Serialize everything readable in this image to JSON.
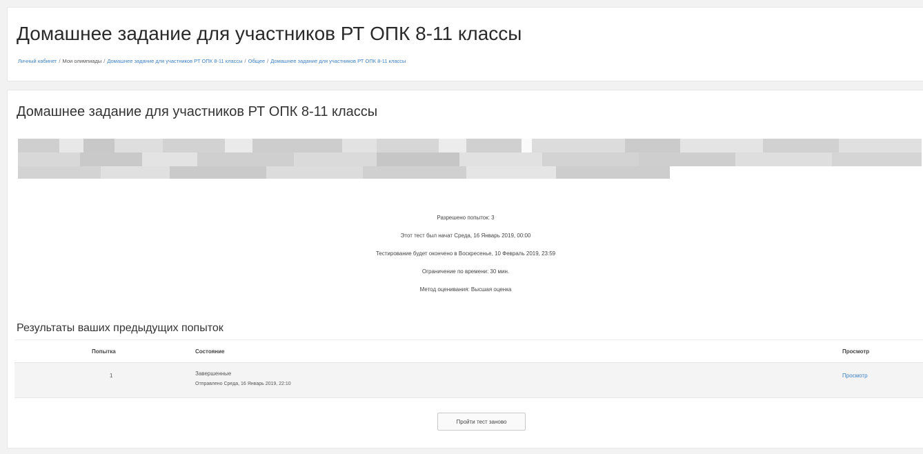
{
  "header": {
    "title": "Домашнее задание для участников РТ ОПК 8-11 классы",
    "breadcrumb": [
      {
        "label": "Личный кабинет",
        "link": true
      },
      {
        "label": "Мои олимпиады",
        "link": false
      },
      {
        "label": "Домашнее задание для участников РТ ОПК 8-11 классы",
        "link": true
      },
      {
        "label": "Общее",
        "link": true
      },
      {
        "label": "Домашнее задание для участников РТ ОПК 8-11 классы",
        "link": true
      }
    ],
    "breadcrumb_separator": "/"
  },
  "quiz": {
    "title": "Домашнее задание для участников РТ ОПК 8-11 классы",
    "info": {
      "attempts": "Разрешено попыток: 3",
      "opened": "Этот тест был начат Среда, 16 Январь 2019, 00:00",
      "closes": "Тестирование будет окончено в Воскресенье, 10 Февраль 2019, 23:59",
      "time_limit": "Ограничение по времени: 30 мин.",
      "grading_method": "Метод оценивания: Высшая оценка"
    }
  },
  "results": {
    "title": "Результаты ваших предыдущих попыток",
    "columns": {
      "attempt": "Попытка",
      "state": "Состояние",
      "review": "Просмотр"
    },
    "rows": [
      {
        "attempt": "1",
        "state": "Завершенные",
        "submitted": "Отправлено Среда, 16 Январь 2019, 22:10",
        "review_link": "Просмотр"
      }
    ]
  },
  "actions": {
    "retry_label": "Пройти тест заново"
  },
  "colors": {
    "link": "#3b7fc4",
    "background": "#f2f2f2",
    "row_background": "#f4f4f4"
  }
}
